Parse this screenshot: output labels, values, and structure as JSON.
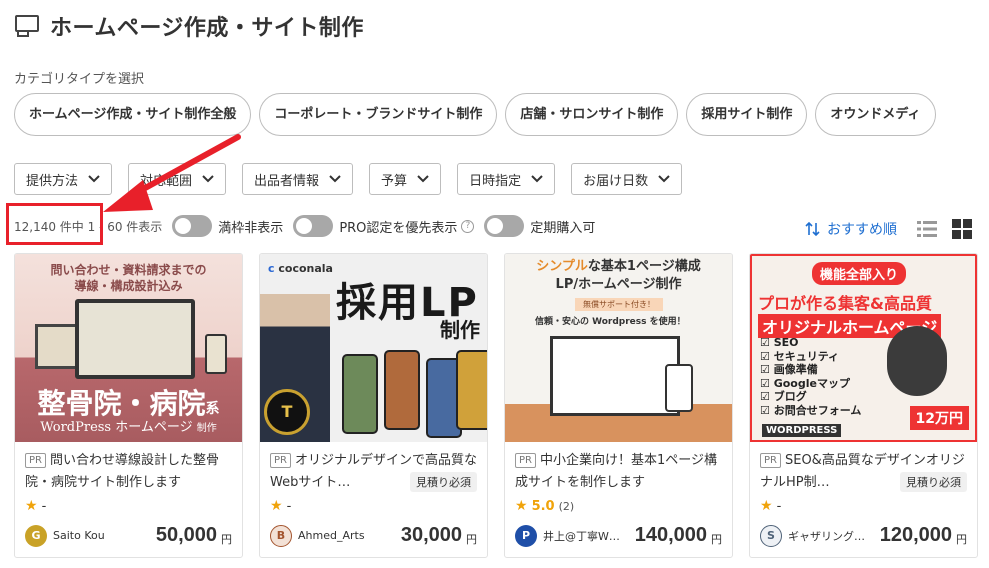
{
  "header": {
    "title": "ホームページ作成・サイト制作",
    "icon": "monitor-icon"
  },
  "category_section": {
    "label": "カテゴリタイプを選択",
    "items": [
      "ホームページ作成・サイト制作全般",
      "コーポレート・ブランドサイト制作",
      "店舗・サロンサイト制作",
      "採用サイト制作",
      "オウンドメディ"
    ]
  },
  "filters": [
    "提供方法",
    "対応範囲",
    "出品者情報",
    "予算",
    "日時指定",
    "お届け日数"
  ],
  "results": {
    "count": "12,140 件中 1 - 60 件表示",
    "toggles": [
      "満枠非表示",
      "PRO認定を優先表示",
      "定期購入可"
    ],
    "help_icon": "?",
    "sort_label": "おすすめ順"
  },
  "colors": {
    "accent": "#1f6fd1",
    "highlight": "#e8202a",
    "star": "#f0a30a"
  },
  "cards": [
    {
      "pr": "PR",
      "title": "問い合わせ導線設計した整骨院・病院サイト制作します",
      "estimate": "",
      "rating": "-",
      "rating_count": "",
      "seller": "Saito Kou",
      "avatar_letter": "G",
      "avatar_color": "#c9a227",
      "price": "50,000",
      "yen": "円",
      "thumb": {
        "top": "問い合わせ・資料請求までの\n導線・構成設計込み",
        "big": "整骨院・病院",
        "big_suffix": "系",
        "small": "WordPress ホームページ",
        "small_suffix": "制作"
      }
    },
    {
      "pr": "PR",
      "title": "オリジナルデザインで高品質なWebサイト…",
      "estimate": "見積り必須",
      "rating": "-",
      "rating_count": "",
      "seller": "Ahmed_Arts",
      "avatar_letter": "B",
      "avatar_color": "#c98b6a",
      "price": "30,000",
      "yen": "円",
      "thumb": {
        "logo_prefix": "c",
        "logo": "coconala",
        "big": "採用LP",
        "sub": "制作"
      }
    },
    {
      "pr": "PR",
      "title": "中小企業向け！基本1ページ構成サイトを制作します",
      "estimate": "",
      "rating": "5.0",
      "rating_count": "(2)",
      "seller": "井上@丁寧W…",
      "avatar_letter": "P",
      "avatar_color": "#1f4fa8",
      "price": "140,000",
      "yen": "円",
      "thumb": {
        "h1_accent": "シンプル",
        "h1_rest": "な基本1ページ構成",
        "h2": "LP/ホームページ制作",
        "tag": "無償サポート付き！",
        "line": "信頼・安心の Wordpress を使用！"
      }
    },
    {
      "pr": "PR",
      "title": "SEO&高品質なデザインオリジナルHP制…",
      "estimate": "見積り必須",
      "rating": "-",
      "rating_count": "",
      "seller": "ギャザリング…",
      "avatar_letter": "S",
      "avatar_color": "#6a7f96",
      "price": "120,000",
      "yen": "円",
      "thumb": {
        "banner": "機能全部入り",
        "h": "プロが作る集客&高品質",
        "h2": "オリジナルホームページ",
        "list": [
          "SEO",
          "セキュリティ",
          "画像準備",
          "Googleマップ",
          "ブログ",
          "お問合せフォーム"
        ],
        "badge": "12万円",
        "wp": "WORDPRESS"
      }
    }
  ]
}
